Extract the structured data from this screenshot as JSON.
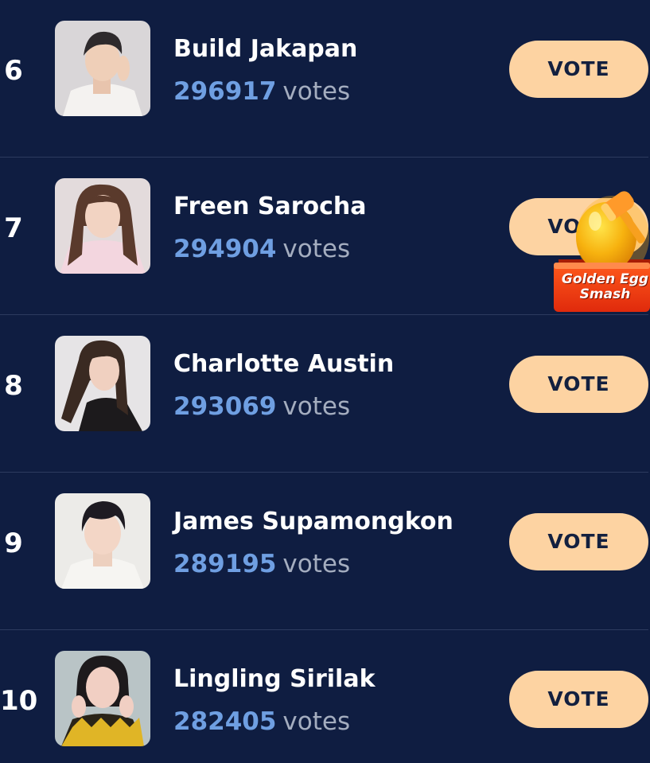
{
  "leaderboard": {
    "vote_unit": "votes",
    "vote_button_label": "VOTE",
    "entries": [
      {
        "rank": "6",
        "name": "Build Jakapan",
        "votes": "296917"
      },
      {
        "rank": "7",
        "name": "Freen Sarocha",
        "votes": "294904"
      },
      {
        "rank": "8",
        "name": "Charlotte Austin",
        "votes": "293069"
      },
      {
        "rank": "9",
        "name": "James Supamongkon",
        "votes": "289195"
      },
      {
        "rank": "10",
        "name": "Lingling Sirilak",
        "votes": "282405"
      }
    ]
  },
  "promo": {
    "line1": "Golden Egg",
    "line2": "Smash",
    "icon": "golden-egg-hammer-icon"
  },
  "colors": {
    "background": "#0f1d41",
    "vote_button": "#fdd3a2",
    "vote_count": "#6f9fe2",
    "vote_unit": "#a4adbf",
    "divider": "#2d3b5f"
  }
}
